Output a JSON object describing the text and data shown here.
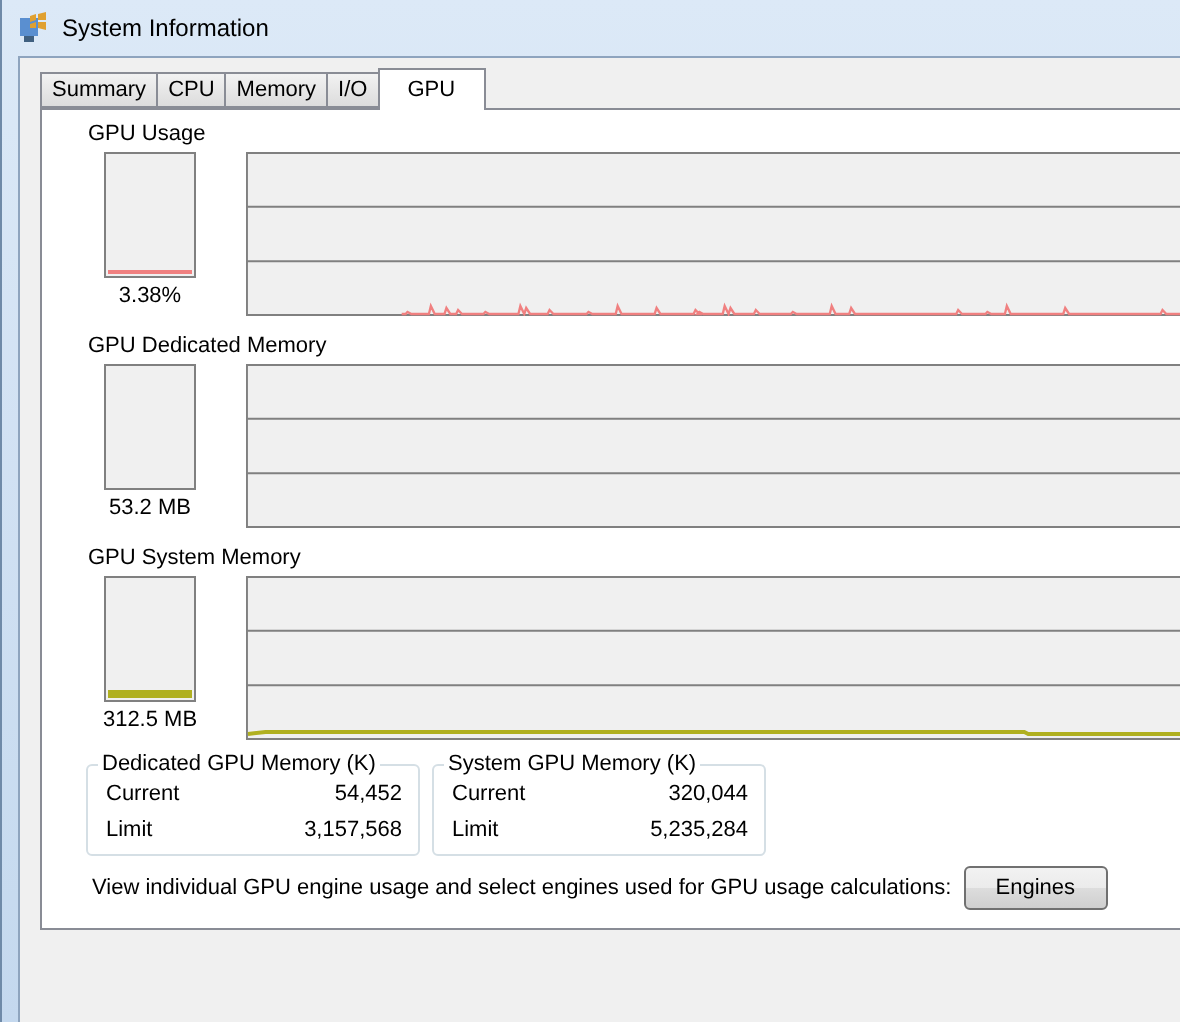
{
  "window": {
    "title": "System Information"
  },
  "tabs": [
    {
      "label": "Summary",
      "selected": false
    },
    {
      "label": "CPU",
      "selected": false
    },
    {
      "label": "Memory",
      "selected": false
    },
    {
      "label": "I/O",
      "selected": false
    },
    {
      "label": "GPU",
      "selected": true
    }
  ],
  "sections": [
    {
      "title": "GPU Usage",
      "reading": "3.38%",
      "level": 0.034,
      "color": "#f08080",
      "kind": "spikes"
    },
    {
      "title": "GPU Dedicated Memory",
      "reading": "53.2 MB",
      "kind": "flat"
    },
    {
      "title": "GPU System Memory",
      "reading": "312.5 MB",
      "level": 0.06,
      "color": "#b0b020",
      "kind": "line"
    }
  ],
  "groups": [
    {
      "title": "Dedicated GPU Memory (K)",
      "rows": [
        {
          "label": "Current",
          "value": "54,452"
        },
        {
          "label": "Limit",
          "value": "3,157,568"
        }
      ]
    },
    {
      "title": "System GPU Memory (K)",
      "rows": [
        {
          "label": "Current",
          "value": "320,044"
        },
        {
          "label": "Limit",
          "value": "5,235,284"
        }
      ]
    }
  ],
  "footer": {
    "text": "View individual GPU engine usage and select engines used for GPU usage calculations:",
    "button": "Engines"
  }
}
